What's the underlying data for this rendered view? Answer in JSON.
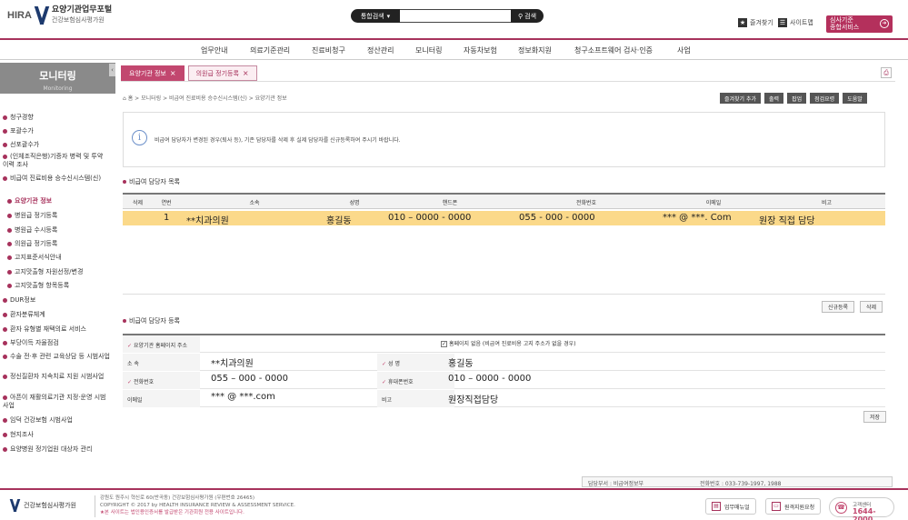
{
  "header": {
    "brand": "HIRA",
    "portal_title": "요양기관업무포털",
    "org_name": "건강보험심사평가원",
    "search_category": "통합검색",
    "search_placeholder": "",
    "search_button": "검색",
    "favorites_label": "즐겨찾기",
    "sitemap_label": "사이트맵",
    "service_button_line1": "심사기준",
    "service_button_line2": "종합서비스"
  },
  "gnb": [
    "업무안내",
    "의료기준관리",
    "진료비청구",
    "정산관리",
    "모니터링",
    "자동차보험",
    "정보화지원",
    "청구소프트웨어 검사·인증",
    "사업"
  ],
  "sidebar": {
    "title": "모니터링",
    "subtitle": "Monitoring",
    "items": [
      {
        "label": "청구경향",
        "sub": false
      },
      {
        "label": "포괄수가",
        "sub": false
      },
      {
        "label": "선포괄수가",
        "sub": false
      },
      {
        "label": "(인체조직은행)기증자 병력 및 투약이력 조사",
        "sub": false
      },
      {
        "label": "비급여 진료비용 승수신시스템(신)",
        "sub": false
      },
      {
        "label": "요양기관 정보",
        "sub": true,
        "active": true
      },
      {
        "label": "병원급 정기등록",
        "sub": true
      },
      {
        "label": "병원급 수시등록",
        "sub": true
      },
      {
        "label": "의원급 정기등록",
        "sub": true
      },
      {
        "label": "고지표준서식안내",
        "sub": true
      },
      {
        "label": "고지맛출형 자원선정/변경",
        "sub": true
      },
      {
        "label": "고지맛출형 항목등록",
        "sub": true
      },
      {
        "label": "DUR정보",
        "sub": false
      },
      {
        "label": "환자분류체계",
        "sub": false
      },
      {
        "label": "환자 유형별 재택의료 서비스",
        "sub": false
      },
      {
        "label": "부당이득 자율점검",
        "sub": false
      },
      {
        "label": "수술 전·후 관련 교육상담 등 시범사업",
        "sub": false
      },
      {
        "label": "정신질환자 지속치료 지원 시범사업",
        "sub": false
      },
      {
        "label": "아픈이 재활의료기관 지정·운영 시범사업",
        "sub": false
      },
      {
        "label": "임덕 건강보험 시범사업",
        "sub": false
      },
      {
        "label": "현지조사",
        "sub": false
      },
      {
        "label": "요양병원 정기업원 대상자 관리",
        "sub": false
      }
    ]
  },
  "tabs": [
    {
      "label": "요양기관 정보",
      "active": true
    },
    {
      "label": "의원급 정기등록",
      "active": false
    }
  ],
  "breadcrumb": "홈 > 모니터링 > 비급여 진료비용 승수신시스템(신) > 요양기관 정보",
  "toolbar": [
    "즐겨찾기 추가",
    "출력",
    "팝업",
    "점검요령",
    "도움말"
  ],
  "notice": "비급여 담당자가 변경된 경우(퇴사 등), 기존 담당자를 삭제 후 실제 담당자를 신규등록하여 주시기 바랍니다.",
  "list_section_title": "비급여 담당자 목록",
  "table": {
    "headers": [
      "삭제",
      "연번",
      "소속",
      "성명",
      "핸드폰",
      "전화번호",
      "이메일",
      "비고"
    ],
    "rows": [
      {
        "no": "1",
        "dept": "**치과의원",
        "name": "홍길동",
        "mobile": "010 – 0000 - 0000",
        "phone": "055 - 000 - 0000",
        "email": "*** @ ***. Com",
        "note": "원장 직접 담당"
      }
    ]
  },
  "list_buttons": {
    "new": "신규등록",
    "delete": "삭제"
  },
  "form_section_title": "비급여 담당자 등록",
  "form": {
    "addr_label": "요양기관 홈페이지 주소",
    "no_homepage_label": "홈페이지 없음 (비급여 진료비용 고지 주소가 없을 경우)",
    "dept_label": "소 속",
    "dept_value": "**치과의원",
    "name_label": "성 명",
    "name_value": "홍길동",
    "phone_label": "전화번호",
    "phone_value": "055 – 000 - 0000",
    "mobile_label": "휴대폰번호",
    "mobile_value": "010 – 0000 - 0000",
    "email_label": "이메일",
    "email_value": "*** @ ***.com",
    "note_label": "비고",
    "note_value": "원장직접담당",
    "save_button": "저장"
  },
  "department": "담당부서 : 비급여정보부",
  "department_phone": "전화번호 : 033-739-1997, 1988",
  "footer": {
    "org_name": "건강보험심사평가원",
    "address": "강원도 원주시 혁신로 60(반곡동) 건강보험심사평가원 (우편번호 26465)",
    "copyright": "COPYRIGHT © 2017 by HEALTH INSURANCE REVIEW & ASSESSMENT SERVICE.",
    "warning": "★본 사이트는 법인용인증서를 발급받은 기관회원 전용 사이트입니다.",
    "btn_manual": "업무매뉴얼",
    "btn_remote": "원격지원요청",
    "call_label": "고객센터",
    "call_number": "1644-2000"
  }
}
